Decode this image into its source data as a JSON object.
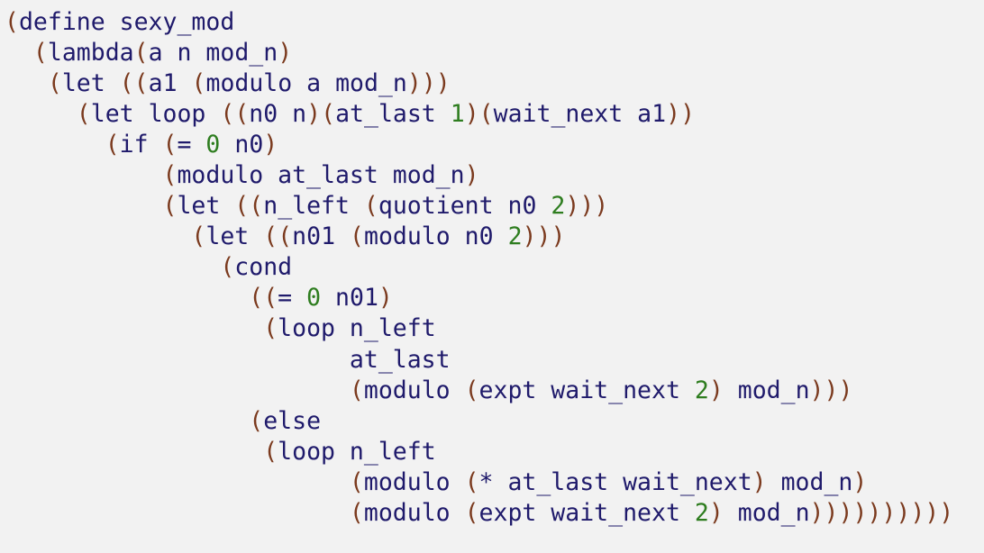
{
  "code": {
    "language": "scheme",
    "colors": {
      "background": "#f2f2f2",
      "identifier": "#1f1a6b",
      "paren": "#7b3a1e",
      "number": "#2e7d1f"
    },
    "lines": [
      "(define sexy_mod",
      "  (lambda(a n mod_n)",
      "   (let ((a1 (modulo a mod_n)))",
      "     (let loop ((n0 n)(at_last 1)(wait_next a1))",
      "       (if (= 0 n0)",
      "           (modulo at_last mod_n)",
      "           (let ((n_left (quotient n0 2)))",
      "             (let ((n01 (modulo n0 2)))",
      "               (cond",
      "                 ((= 0 n01)",
      "                  (loop n_left",
      "                        at_last",
      "                        (modulo (expt wait_next 2) mod_n)))",
      "                 (else",
      "                  (loop n_left",
      "                        (modulo (* at_last wait_next) mod_n)",
      "                        (modulo (expt wait_next 2) mod_n))))))))))"
    ]
  }
}
